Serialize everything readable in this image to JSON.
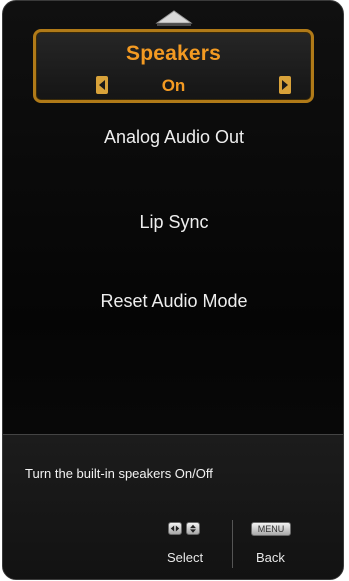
{
  "menu": {
    "selected": {
      "label": "Speakers",
      "value": "On"
    },
    "items": [
      {
        "label": "Analog Audio Out"
      },
      {
        "label": "Lip Sync"
      },
      {
        "label": "Reset Audio Mode"
      }
    ]
  },
  "footer": {
    "help_text": "Turn the built-in speakers On/Off",
    "select_label": "Select",
    "menu_key_label": "MENU",
    "back_label": "Back"
  },
  "colors": {
    "accent": "#f39a22",
    "frame": "#b07a18",
    "background": "#0a0a0a",
    "text": "#eeeeee"
  },
  "icons": {
    "scroll_up": "scroll-up-arrow-icon",
    "left": "left-arrow-icon",
    "right": "right-arrow-icon",
    "nav_keys": "left-right-arrow-key-icon",
    "updown_keys": "up-down-arrow-key-icon",
    "menu_key": "menu-key-icon"
  }
}
